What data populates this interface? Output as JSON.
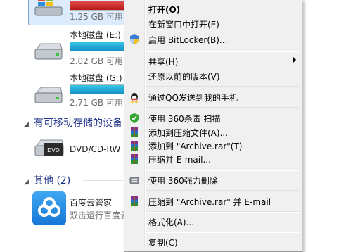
{
  "explorer": {
    "drives": [
      {
        "free_text": "1.25 GB 可用",
        "usage": 0.95,
        "bar_color": "#c61e1e"
      },
      {
        "name": "本地磁盘 (E:)",
        "free_text": "2.02 GB 可用",
        "usage": 0.98,
        "bar_color": "#1691c4"
      },
      {
        "name": "本地磁盘 (G:)",
        "free_text": "2.71 GB 可用",
        "usage": 0.97,
        "bar_color": "#1691c4"
      }
    ],
    "removable_header": "有可移动存储的设备",
    "dvd_label": "DVD/CD-RW",
    "dvd_badge": "DVD",
    "other_header": "其他 (2)",
    "baidu": {
      "name": "百度云管家",
      "desc": "双击运行百度云管家"
    }
  },
  "context_menu": {
    "items": [
      {
        "label": "打开(O)",
        "bold": true
      },
      {
        "label": "在新窗口中打开(E)"
      },
      {
        "label": "启用 BitLocker(B)...",
        "icon": "uac-shield-icon"
      },
      {
        "label": "共享(H)",
        "submenu": true
      },
      {
        "label": "还原以前的版本(V)"
      },
      {
        "label": "通过QQ发送到我的手机",
        "icon": "qq-penguin-icon"
      },
      {
        "label": "使用 360杀毒 扫描",
        "icon": "360-shield-icon"
      },
      {
        "label": "添加到压缩文件(A)...",
        "icon": "winrar-icon"
      },
      {
        "label": "添加到 \"Archive.rar\"(T)",
        "icon": "winrar-icon"
      },
      {
        "label": "压缩并 E-mail...",
        "icon": "winrar-icon"
      },
      {
        "label": "使用 360强力删除",
        "icon": "360-delete-icon"
      },
      {
        "label": "压缩到 \"Archive.rar\" 并 E-mail",
        "icon": "winrar-icon"
      },
      {
        "label": "格式化(A)..."
      },
      {
        "label": "复制(C)"
      }
    ]
  },
  "colors": {
    "accent": "#1e3287",
    "menu_bg": "#f0f0f0",
    "selection": "#dcecfc"
  }
}
